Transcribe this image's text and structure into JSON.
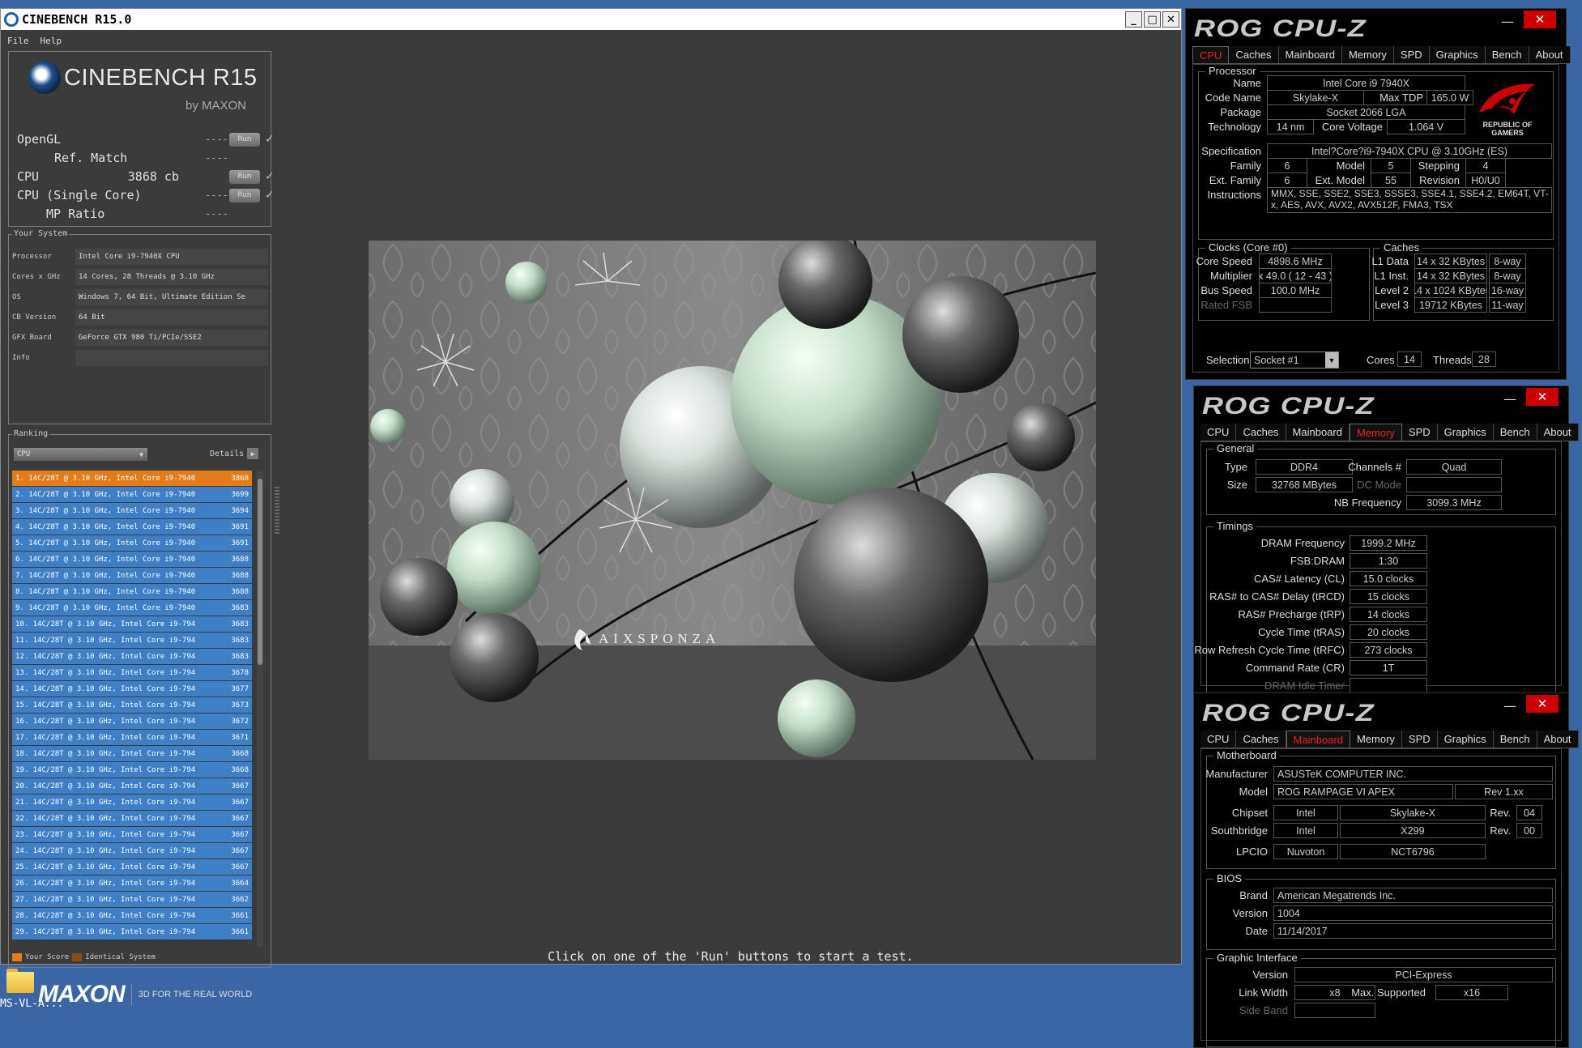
{
  "cinebench": {
    "title": "CINEBENCH R15.0",
    "menu": [
      "File",
      "Help"
    ],
    "logo": {
      "name": "CINEBENCH R15",
      "by": "by MAXON"
    },
    "bench": [
      {
        "label": "OpenGL",
        "value": "",
        "dash": "----",
        "run": "Run",
        "check": "✓"
      },
      {
        "label": "Ref. Match",
        "value": "",
        "dash": "----"
      },
      {
        "label": "CPU",
        "value": "3868 cb",
        "dash": "",
        "run": "Run",
        "check": "✓"
      },
      {
        "label": "CPU (Single Core)",
        "value": "",
        "dash": "----",
        "run": "Run",
        "check": "✓"
      },
      {
        "label": "MP Ratio",
        "value": "",
        "dash": "----"
      }
    ],
    "system": {
      "title": "Your System",
      "rows": [
        {
          "k": "Processor",
          "v": "Intel Core i9-7940X CPU"
        },
        {
          "k": "Cores x GHz",
          "v": "14 Cores, 28 Threads @ 3.10 GHz"
        },
        {
          "k": "OS",
          "v": "Windows 7, 64 Bit, Ultimate Edition Se"
        },
        {
          "k": "CB Version",
          "v": "64 Bit"
        },
        {
          "k": "GFX Board",
          "v": "GeForce GTX 980 Ti/PCIe/SSE2"
        },
        {
          "k": "Info",
          "v": ""
        }
      ]
    },
    "ranking": {
      "title": "Ranking",
      "select": "CPU",
      "details": "Details",
      "items": [
        {
          "t": "1.  14C/28T @ 3.10 GHz, Intel Core i9-7940",
          "s": "3868",
          "you": true
        },
        {
          "t": "2.  14C/28T @ 3.10 GHz, Intel Core i9-7940",
          "s": "3699"
        },
        {
          "t": "3.  14C/28T @ 3.10 GHz, Intel Core i9-7940",
          "s": "3694"
        },
        {
          "t": "4.  14C/28T @ 3.10 GHz, Intel Core i9-7940",
          "s": "3691"
        },
        {
          "t": "5.  14C/28T @ 3.10 GHz, Intel Core i9-7940",
          "s": "3691"
        },
        {
          "t": "6.  14C/28T @ 3.10 GHz, Intel Core i9-7940",
          "s": "3688"
        },
        {
          "t": "7.  14C/28T @ 3.10 GHz, Intel Core i9-7940",
          "s": "3688"
        },
        {
          "t": "8.  14C/28T @ 3.10 GHz, Intel Core i9-7940",
          "s": "3688"
        },
        {
          "t": "9.  14C/28T @ 3.10 GHz, Intel Core i9-7940",
          "s": "3683"
        },
        {
          "t": "10.  14C/28T @ 3.10 GHz, Intel Core i9-794",
          "s": "3683"
        },
        {
          "t": "11.  14C/28T @ 3.10 GHz, Intel Core i9-794",
          "s": "3683"
        },
        {
          "t": "12.  14C/28T @ 3.10 GHz, Intel Core i9-794",
          "s": "3683"
        },
        {
          "t": "13.  14C/28T @ 3.10 GHz, Intel Core i9-794",
          "s": "3678"
        },
        {
          "t": "14.  14C/28T @ 3.10 GHz, Intel Core i9-794",
          "s": "3677"
        },
        {
          "t": "15.  14C/28T @ 3.10 GHz, Intel Core i9-794",
          "s": "3673"
        },
        {
          "t": "16.  14C/28T @ 3.10 GHz, Intel Core i9-794",
          "s": "3672"
        },
        {
          "t": "17.  14C/28T @ 3.10 GHz, Intel Core i9-794",
          "s": "3671"
        },
        {
          "t": "18.  14C/28T @ 3.10 GHz, Intel Core i9-794",
          "s": "3668"
        },
        {
          "t": "19.  14C/28T @ 3.10 GHz, Intel Core i9-794",
          "s": "3668"
        },
        {
          "t": "20.  14C/28T @ 3.10 GHz, Intel Core i9-794",
          "s": "3667"
        },
        {
          "t": "21.  14C/28T @ 3.10 GHz, Intel Core i9-794",
          "s": "3667"
        },
        {
          "t": "22.  14C/28T @ 3.10 GHz, Intel Core i9-794",
          "s": "3667"
        },
        {
          "t": "23.  14C/28T @ 3.10 GHz, Intel Core i9-794",
          "s": "3667"
        },
        {
          "t": "24.  14C/28T @ 3.10 GHz, Intel Core i9-794",
          "s": "3667"
        },
        {
          "t": "25.  14C/28T @ 3.10 GHz, Intel Core i9-794",
          "s": "3667"
        },
        {
          "t": "26.  14C/28T @ 3.10 GHz, Intel Core i9-794",
          "s": "3664"
        },
        {
          "t": "27.  14C/28T @ 3.10 GHz, Intel Core i9-794",
          "s": "3662"
        },
        {
          "t": "28.  14C/28T @ 3.10 GHz, Intel Core i9-794",
          "s": "3661"
        },
        {
          "t": "29.  14C/28T @ 3.10 GHz, Intel Core i9-794",
          "s": "3661"
        }
      ],
      "legend_your": "Your Score",
      "legend_identical": "Identical System"
    },
    "maxon": {
      "brand": "MAXON",
      "tagline": "3D FOR THE REAL WORLD"
    },
    "render_watermark": "AIXSPONZA",
    "status": "Click on one of the 'Run' buttons to start a test.",
    "colors": {
      "your_score": "#e57a18",
      "identical": "#8a4a10",
      "rank_bar": "#3e7fc6"
    }
  },
  "desktop_icon": {
    "label": "MS-VL-A..."
  },
  "cpuz_cpu": {
    "brand": "ROG CPU-Z",
    "tabs": [
      "CPU",
      "Caches",
      "Mainboard",
      "Memory",
      "SPD",
      "Graphics",
      "Bench",
      "About"
    ],
    "active": "CPU",
    "processor_title": "Processor",
    "name_lbl": "Name",
    "name": "Intel Core i9 7940X",
    "codename_lbl": "Code Name",
    "codename": "Skylake-X",
    "maxtdp_lbl": "Max TDP",
    "maxtdp": "165.0 W",
    "package_lbl": "Package",
    "package": "Socket 2066 LGA",
    "tech_lbl": "Technology",
    "tech": "14 nm",
    "corevolt_lbl": "Core Voltage",
    "corevolt": "1.064 V",
    "spec_lbl": "Specification",
    "spec": "Intel?Core?i9-7940X CPU @ 3.10GHz (ES)",
    "family_lbl": "Family",
    "family": "6",
    "model_lbl": "Model",
    "model": "5",
    "stepping_lbl": "Stepping",
    "stepping": "4",
    "extfamily_lbl": "Ext. Family",
    "extfamily": "6",
    "extmodel_lbl": "Ext. Model",
    "extmodel": "55",
    "revision_lbl": "Revision",
    "revision": "H0/U0",
    "instr_lbl": "Instructions",
    "instr": "MMX, SSE, SSE2, SSE3, SSSE3, SSE4.1, SSE4.2, EM64T, VT-x, AES, AVX, AVX2, AVX512F, FMA3, TSX",
    "clocks_title": "Clocks (Core #0)",
    "corespeed_lbl": "Core Speed",
    "corespeed": "4898.6 MHz",
    "mult_lbl": "Multiplier",
    "mult": "x 49.0 ( 12 - 43 )",
    "bus_lbl": "Bus Speed",
    "bus": "100.0 MHz",
    "fsb_lbl": "Rated FSB",
    "fsb": "",
    "caches_title": "Caches",
    "l1d_lbl": "L1 Data",
    "l1d": "14 x 32 KBytes",
    "l1d_way": "8-way",
    "l1i_lbl": "L1 Inst.",
    "l1i": "14 x 32 KBytes",
    "l1i_way": "8-way",
    "l2_lbl": "Level 2",
    "l2": "14 x 1024 KBytes",
    "l2_way": "16-way",
    "l3_lbl": "Level 3",
    "l3": "19712 KBytes",
    "l3_way": "11-way",
    "selection_lbl": "Selection",
    "selection": "Socket #1",
    "cores_lbl": "Cores",
    "cores": "14",
    "threads_lbl": "Threads",
    "threads": "28",
    "emblem": "REPUBLIC OF GAMERS"
  },
  "cpuz_mem": {
    "brand": "ROG CPU-Z",
    "tabs": [
      "CPU",
      "Caches",
      "Mainboard",
      "Memory",
      "SPD",
      "Graphics",
      "Bench",
      "About"
    ],
    "active": "Memory",
    "general_title": "General",
    "type_lbl": "Type",
    "type": "DDR4",
    "size_lbl": "Size",
    "size": "32768 MBytes",
    "channels_lbl": "Channels #",
    "channels": "Quad",
    "dcmode_lbl": "DC Mode",
    "dcmode": "",
    "nbfreq_lbl": "NB Frequency",
    "nbfreq": "3099.3 MHz",
    "timings_title": "Timings",
    "timings": [
      {
        "k": "DRAM Frequency",
        "v": "1999.2 MHz"
      },
      {
        "k": "FSB:DRAM",
        "v": "1:30"
      },
      {
        "k": "CAS# Latency (CL)",
        "v": "15.0 clocks"
      },
      {
        "k": "RAS# to CAS# Delay (tRCD)",
        "v": "15 clocks"
      },
      {
        "k": "RAS# Precharge (tRP)",
        "v": "14 clocks"
      },
      {
        "k": "Cycle Time (tRAS)",
        "v": "20 clocks"
      },
      {
        "k": "Row Refresh Cycle Time (tRFC)",
        "v": "273 clocks"
      },
      {
        "k": "Command Rate (CR)",
        "v": "1T"
      },
      {
        "k": "DRAM Idle Timer",
        "v": ""
      }
    ]
  },
  "cpuz_mb": {
    "brand": "ROG CPU-Z",
    "tabs": [
      "CPU",
      "Caches",
      "Mainboard",
      "Memory",
      "SPD",
      "Graphics",
      "Bench",
      "About"
    ],
    "active": "Mainboard",
    "mb_title": "Motherboard",
    "manu_lbl": "Manufacturer",
    "manu": "ASUSTeK COMPUTER INC.",
    "model_lbl": "Model",
    "model": "ROG RAMPAGE VI APEX",
    "model_rev": "Rev 1.xx",
    "chipset_lbl": "Chipset",
    "chipset_v": "Intel",
    "chipset_n": "Skylake-X",
    "chipset_rev_lbl": "Rev.",
    "chipset_rev": "04",
    "south_lbl": "Southbridge",
    "south_v": "Intel",
    "south_n": "X299",
    "south_rev_lbl": "Rev.",
    "south_rev": "00",
    "lpcio_lbl": "LPCIO",
    "lpcio_v": "Nuvoton",
    "lpcio_n": "NCT6796",
    "bios_title": "BIOS",
    "brand_lbl": "Brand",
    "bios_brand": "American Megatrends Inc.",
    "version_lbl": "Version",
    "bios_version": "1004",
    "date_lbl": "Date",
    "bios_date": "11/14/2017",
    "gi_title": "Graphic Interface",
    "giver_lbl": "Version",
    "giver": "PCI-Express",
    "lw_lbl": "Link Width",
    "lw": "x8",
    "ms_lbl": "Max. Supported",
    "ms": "x16",
    "sb_lbl": "Side Band",
    "sb": ""
  }
}
